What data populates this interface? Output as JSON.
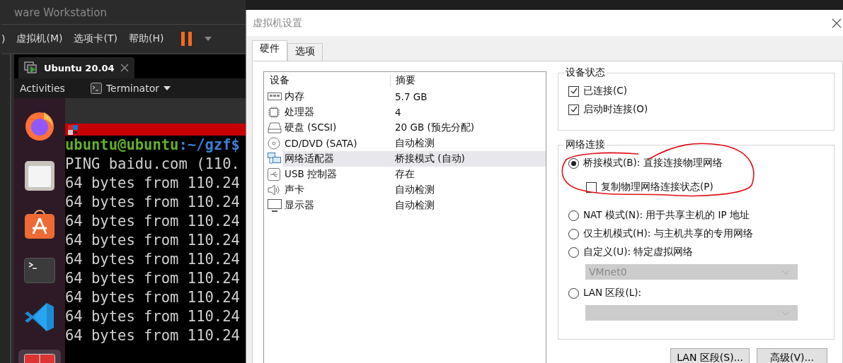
{
  "background_app": {
    "title": "ware Workstation",
    "menu": [
      ")",
      "虚拟机(M)",
      "选项卡(T)",
      "帮助(H)"
    ],
    "vm_tab": {
      "label": "Ubuntu 20.04"
    },
    "guest_topbar": {
      "activities": "Activities",
      "app_menu": "Terminator"
    },
    "dock": [
      {
        "kind": "firefox",
        "selected": false
      },
      {
        "kind": "files",
        "selected": false
      },
      {
        "kind": "store",
        "selected": false
      },
      {
        "kind": "terminal",
        "selected": false
      },
      {
        "kind": "vscode",
        "selected": false
      },
      {
        "kind": "terminator",
        "selected": true
      }
    ],
    "terminal": {
      "prompt_user": "ubuntu@ubuntu",
      "prompt_path": ":~/gzf$",
      "lines": [
        "PING baidu.com (110.",
        "64 bytes from 110.24",
        "64 bytes from 110.24",
        "64 bytes from 110.24",
        "64 bytes from 110.24",
        "64 bytes from 110.24",
        "64 bytes from 110.24",
        "64 bytes from 110.24",
        "64 bytes from 110.24",
        "64 bytes from 110.24"
      ]
    }
  },
  "dialog": {
    "title": "虚拟机设置",
    "tabs": [
      {
        "label": "硬件",
        "selected": true
      },
      {
        "label": "选项",
        "selected": false
      }
    ],
    "device_table": {
      "columns": [
        "设备",
        "摘要"
      ],
      "rows": [
        {
          "kind": "memory",
          "device": "内存",
          "summary": "5.7 GB",
          "selected": false
        },
        {
          "kind": "cpu",
          "device": "处理器",
          "summary": "4",
          "selected": false
        },
        {
          "kind": "disk",
          "device": "硬盘 (SCSI)",
          "summary": "20 GB (预先分配)",
          "selected": false
        },
        {
          "kind": "cd",
          "device": "CD/DVD (SATA)",
          "summary": "自动检测",
          "selected": false
        },
        {
          "kind": "network",
          "device": "网络适配器",
          "summary": "桥接模式 (自动)",
          "selected": true
        },
        {
          "kind": "usb",
          "device": "USB 控制器",
          "summary": "存在",
          "selected": false
        },
        {
          "kind": "sound",
          "device": "声卡",
          "summary": "自动检测",
          "selected": false
        },
        {
          "kind": "display",
          "device": "显示器",
          "summary": "自动检测",
          "selected": false
        }
      ]
    },
    "device_status": {
      "title": "设备状态",
      "options": [
        {
          "label": "已连接(C)",
          "checked": true
        },
        {
          "label": "启动时连接(O)",
          "checked": true
        }
      ]
    },
    "network": {
      "title": "网络连接",
      "options": [
        {
          "kind": "radio",
          "label": "桥接模式(B): 直接连接物理网络",
          "selected": true
        },
        {
          "kind": "checkbox",
          "label": "复制物理网络连接状态(P)",
          "checked": false
        },
        {
          "kind": "radio",
          "label": "NAT 模式(N): 用于共享主机的 IP 地址",
          "selected": false
        },
        {
          "kind": "radio",
          "label": "仅主机模式(H): 与主机共享的专用网络",
          "selected": false
        },
        {
          "kind": "radio",
          "label": "自定义(U): 特定虚拟网络",
          "selected": false
        },
        {
          "kind": "dropdown",
          "value": "VMnet0",
          "disabled": true
        },
        {
          "kind": "radio",
          "label": "LAN 区段(L):",
          "selected": false
        },
        {
          "kind": "dropdown",
          "disabled": true
        }
      ]
    },
    "buttons": [
      "LAN 区段(S)...",
      "高级(V)..."
    ]
  }
}
